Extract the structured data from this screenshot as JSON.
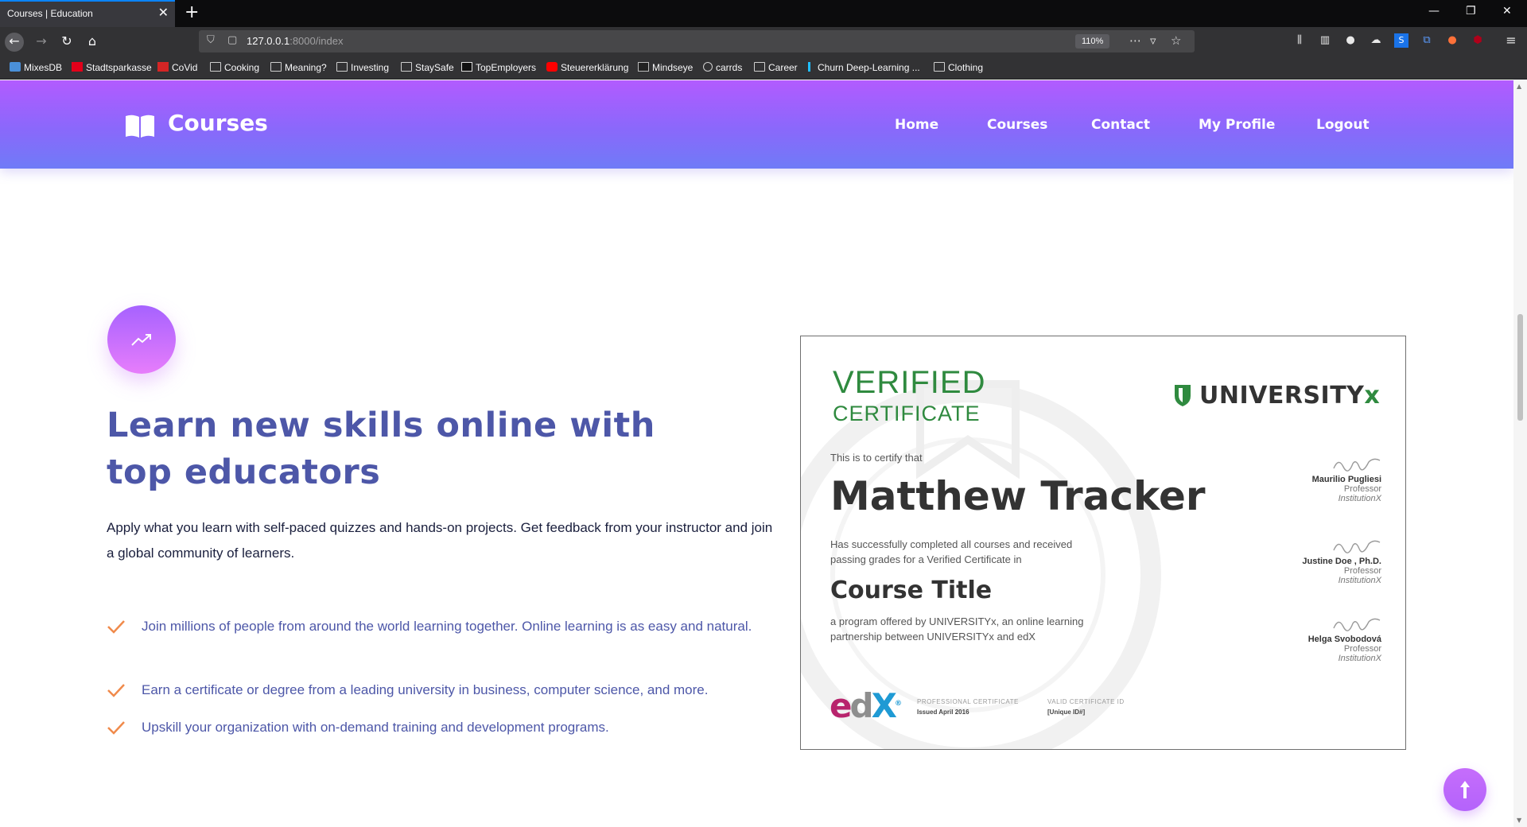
{
  "browser": {
    "tab_title": "Courses | Education",
    "tab_close": "✕",
    "new_tab": "+",
    "url_host": "127.0.0.1",
    "url_path": ":8000/index",
    "zoom": "110%",
    "window_controls": {
      "minimize": "—",
      "restore": "❐",
      "close": "✕"
    },
    "bookmarks": [
      {
        "label": "MixesDB",
        "icon": "mixesdb-icon"
      },
      {
        "label": "Stadtsparkasse",
        "icon": "sparkasse-icon"
      },
      {
        "label": "CoVid",
        "icon": "covid-icon"
      },
      {
        "label": "Cooking",
        "icon": "folder-icon"
      },
      {
        "label": "Meaning?",
        "icon": "folder-icon"
      },
      {
        "label": "Investing",
        "icon": "folder-icon"
      },
      {
        "label": "StaySafe",
        "icon": "folder-icon"
      },
      {
        "label": "TopEmployers",
        "icon": "medium-icon"
      },
      {
        "label": "Steuererklärung",
        "icon": "youtube-icon"
      },
      {
        "label": "Mindseye",
        "icon": "mindseye-icon"
      },
      {
        "label": "carrds",
        "icon": "globe-icon"
      },
      {
        "label": "Career",
        "icon": "folder-icon"
      },
      {
        "label": "Churn Deep-Learning ...",
        "icon": "kaggle-icon"
      },
      {
        "label": "Clothing",
        "icon": "folder-icon"
      }
    ]
  },
  "site": {
    "logo_text": "Courses",
    "menu": [
      "Home",
      "Courses",
      "Contact",
      "My Profile",
      "Logout"
    ]
  },
  "feature": {
    "icon": "trending-up-icon",
    "headline": "Learn new skills online with top educators",
    "intro": "Apply what you learn with self-paced quizzes and hands-on projects. Get feedback from your instructor and join a global community of learners.",
    "points": [
      "Join millions of people from around the world learning together. Online learning is as easy and natural.",
      "Earn a certificate or degree from a leading university in business, computer science, and more.",
      "Upskill your organization with on-demand training and development programs."
    ]
  },
  "certificate": {
    "verified": "VERIFIED",
    "certificate": "CERTIFICATE",
    "university_main": "UNIVERSITY",
    "university_x": "x",
    "certify_text": "This is to certify that",
    "name": "Matthew Tracker",
    "completed_text": "Has successfully completed all courses and received passing grades for a Verified Certificate in",
    "course_title": "Course Title",
    "program_text": "a program offered by UNIVERSITYx, an online learning partnership between UNIVERSITYx and edX",
    "signatories": [
      {
        "name": "Maurilio Pugliesi",
        "title": "Professor",
        "institution": "InstitutionX"
      },
      {
        "name": "Justine Doe , Ph.D.",
        "title": "Professor",
        "institution": "InstitutionX"
      },
      {
        "name": "Helga Svobodová",
        "title": "Professor",
        "institution": "InstitutionX"
      }
    ],
    "edx_e": "e",
    "edx_d": "d",
    "edx_x": "X",
    "edx_mark": "®",
    "professional_label": "PROFESSIONAL CERTIFICATE",
    "issued": "Issued April 2016",
    "valid_label": "VALID CERTIFICATE ID",
    "unique_id": "[Unique ID#]"
  },
  "colors": {
    "header_gradient_top": "#b25bff",
    "header_gradient_bottom": "#6f7bf7",
    "headline": "#4d57a8",
    "check": "#f08a4b",
    "cert_green": "#2f8a3f"
  }
}
